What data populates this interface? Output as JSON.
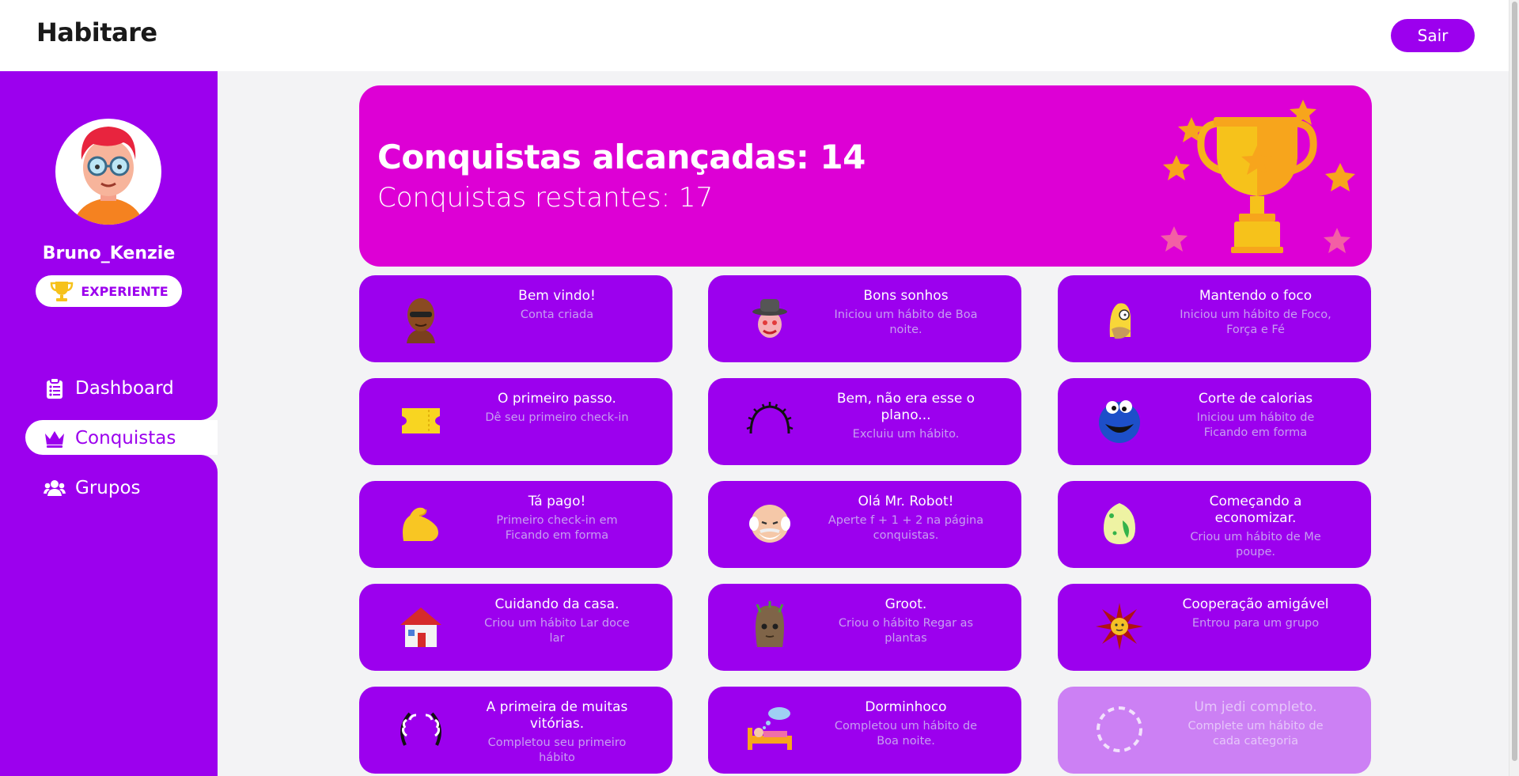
{
  "header": {
    "logo": "Habitare",
    "logout_label": "Sair"
  },
  "profile": {
    "username": "Bruno_Kenzie",
    "badge": "EXPERIENTE"
  },
  "nav": [
    {
      "label": "Dashboard",
      "icon": "clipboard-icon"
    },
    {
      "label": "Conquistas",
      "icon": "crown-icon",
      "active": true
    },
    {
      "label": "Grupos",
      "icon": "users-icon"
    }
  ],
  "banner": {
    "achieved": "Conquistas alcançadas: 14",
    "remaining": "Conquistas restantes: 17"
  },
  "colors": {
    "primary": "#9c00ee",
    "banner": "#dd00d5",
    "locked": "#cc80f4",
    "background": "#f3f3f5"
  },
  "achievements": [
    {
      "title": "Bem vindo!",
      "desc": "Conta criada",
      "icon": "bald-man-icon"
    },
    {
      "title": "Bons sonhos",
      "desc": "Iniciou um hábito de Boa noite.",
      "icon": "hat-man-icon"
    },
    {
      "title": "Mantendo o foco",
      "desc": "Iniciou um hábito de Foco, Força e Fé",
      "icon": "homer-icon"
    },
    {
      "title": "O primeiro passo.",
      "desc": "Dê seu primeiro check-in",
      "icon": "ticket-icon"
    },
    {
      "title": "Bem, não era esse o plano...",
      "desc": "Excluiu um hábito.",
      "icon": "thorn-crown-icon"
    },
    {
      "title": "Corte de calorias",
      "desc": "Iniciou um hábito de Ficando em forma",
      "icon": "cookie-monster-icon"
    },
    {
      "title": "Tá pago!",
      "desc": "Primeiro check-in em Ficando em forma",
      "icon": "flexed-biceps-icon"
    },
    {
      "title": "Olá Mr. Robot!",
      "desc": "Aperte f + 1 + 2 na página conquistas.",
      "icon": "old-man-icon"
    },
    {
      "title": "Começando a economizar.",
      "desc": "Criou um hábito de Me poupe.",
      "icon": "egg-icon"
    },
    {
      "title": "Cuidando da casa.",
      "desc": "Criou um hábito Lar doce lar",
      "icon": "house-icon"
    },
    {
      "title": "Groot.",
      "desc": "Criou o hábito Regar as plantas",
      "icon": "groot-icon"
    },
    {
      "title": "Cooperação amigável",
      "desc": "Entrou para um grupo",
      "icon": "sun-icon"
    },
    {
      "title": "A primeira de muitas vitórias.",
      "desc": "Completou seu primeiro hábito",
      "icon": "laurel-icon"
    },
    {
      "title": "Dorminhoco",
      "desc": "Completou um hábito de Boa noite.",
      "icon": "sleeping-bed-icon"
    },
    {
      "title": "Um jedi completo.",
      "desc": "Complete um hábito de cada categoria",
      "icon": "locked-circle-icon",
      "locked": true
    }
  ]
}
